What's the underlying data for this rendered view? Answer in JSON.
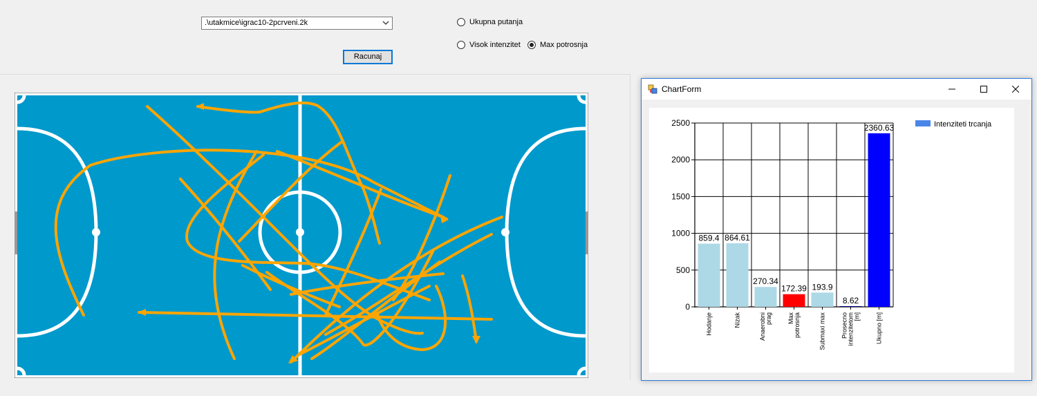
{
  "main": {
    "file_combo": ".\\utakmice\\igrac10-2pcrveni.2k",
    "compute_button": "Racunaj",
    "radios": [
      {
        "label": "Ukupna putanja",
        "checked": false
      },
      {
        "label": "Visok intenzitet",
        "checked": false
      },
      {
        "label": "Max potrosnja",
        "checked": true
      }
    ]
  },
  "court": {
    "colors": {
      "floor": "#0099cc",
      "lines": "#ffffff",
      "paths": "#ffa500"
    }
  },
  "chart_window": {
    "title": "ChartForm",
    "icons": [
      "app-icon",
      "minimize-icon",
      "maximize-icon",
      "close-icon"
    ]
  },
  "chart_data": {
    "type": "bar",
    "categories": [
      "Hodanje",
      "Nizak",
      "Anaerobni prag",
      "Max potrosnja",
      "Submaxi max",
      "Prosecno intenzitetom [m]",
      "Ukupno [m]"
    ],
    "values": [
      859.4,
      864.61,
      270.34,
      172.39,
      193.9,
      8.62,
      2360.63
    ],
    "labels": [
      "859.4",
      "864.61",
      "270.34",
      "172.39",
      "193.9",
      "8.62",
      "2360.63"
    ],
    "colors": [
      "#add8e6",
      "#add8e6",
      "#add8e6",
      "#ff0000",
      "#add8e6",
      "#00008b",
      "#0000ff"
    ],
    "ylim": [
      0,
      2500
    ],
    "yticks": [
      0,
      500,
      1000,
      1500,
      2000,
      2500
    ],
    "grid": true,
    "legend": {
      "label": "Intenziteti trcanja",
      "color": "#4a86e8",
      "position": "top-right"
    },
    "title": "",
    "xlabel": "",
    "ylabel": ""
  }
}
